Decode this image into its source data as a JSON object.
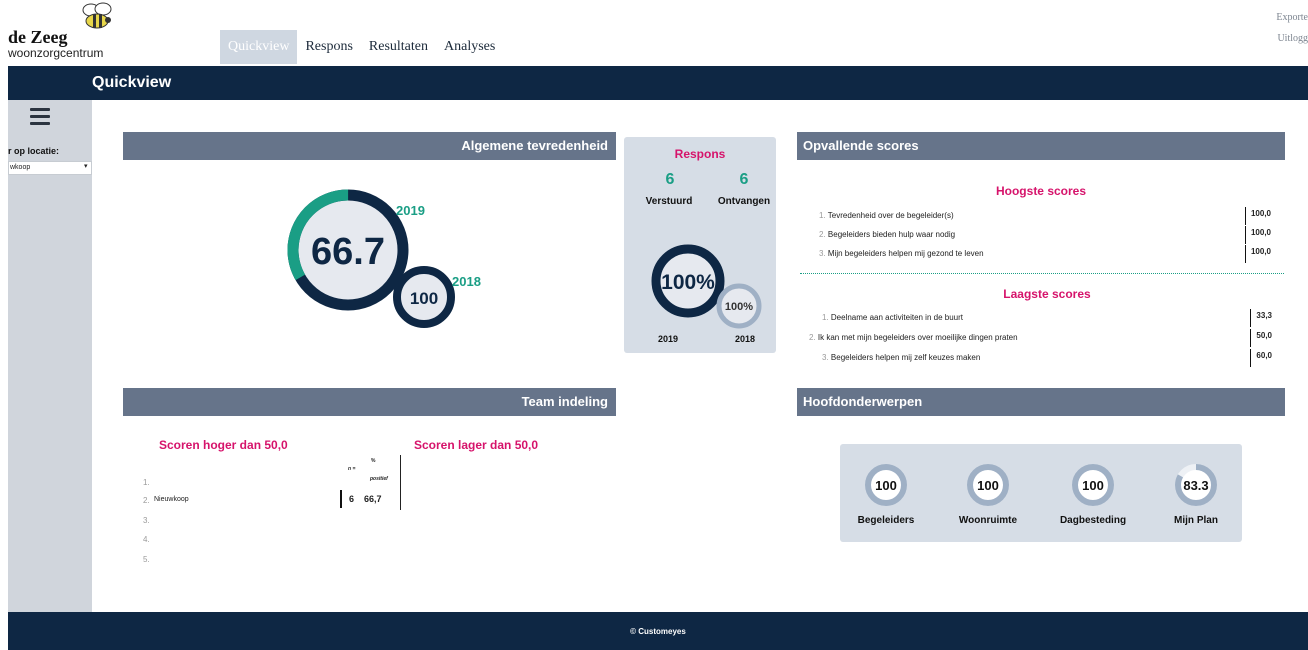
{
  "brand": {
    "name": "de Zeeg",
    "subtitle": "woonzorgcentrum",
    "logo_icon": "bee-icon"
  },
  "nav": {
    "tabs": [
      "Quickview",
      "Respons",
      "Resultaten",
      "Analyses"
    ],
    "active": "Quickview"
  },
  "top_links": {
    "export": "Exporte",
    "logout": "Uitlogg"
  },
  "page": {
    "title": "Quickview"
  },
  "sidebar": {
    "menu_icon": "hamburger-icon",
    "filter_label": "r op locatie:",
    "filter_value": "wkoop"
  },
  "algemene": {
    "title": "Algemene tevredenheid",
    "current": {
      "year": "2019",
      "value": "66.7"
    },
    "previous": {
      "year": "2018",
      "value": "100"
    }
  },
  "respons": {
    "title": "Respons",
    "verstuurd": {
      "value": "6",
      "label": "Verstuurd"
    },
    "ontvangen": {
      "value": "6",
      "label": "Ontvangen"
    },
    "current": {
      "year": "2019",
      "value": "100%"
    },
    "previous": {
      "year": "2018",
      "value": "100%"
    }
  },
  "opvallende": {
    "title": "Opvallende scores",
    "hoogste_title": "Hoogste scores",
    "hoogste": [
      {
        "idx": "1.",
        "label": "Tevredenheid over de begeleider(s)",
        "value": "100,0"
      },
      {
        "idx": "2.",
        "label": "Begeleiders bieden hulp waar nodig",
        "value": "100,0"
      },
      {
        "idx": "3.",
        "label": "Mijn begeleiders helpen mij gezond te leven",
        "value": "100,0"
      }
    ],
    "laagste_title": "Laagste scores",
    "laagste": [
      {
        "idx": "1.",
        "label": "Deelname aan activiteiten in de buurt",
        "value": "33,3"
      },
      {
        "idx": "2.",
        "label": "Ik kan met mijn begeleiders over moeilijke dingen praten",
        "value": "50,0"
      },
      {
        "idx": "3.",
        "label": "Begeleiders helpen mij zelf keuzes maken",
        "value": "60,0"
      }
    ]
  },
  "team": {
    "title": "Team indeling",
    "hoger_title": "Scoren hoger dan 50,0",
    "lager_title": "Scoren lager dan 50,0",
    "col_n": "n =",
    "col_pct_n": "%",
    "col_pct_label": "positief",
    "rows": [
      {
        "idx": "1.",
        "name": "",
        "n": "",
        "pct": ""
      },
      {
        "idx": "2.",
        "name": "Nieuwkoop",
        "n": "6",
        "pct": "66,7"
      },
      {
        "idx": "3.",
        "name": "",
        "n": "",
        "pct": ""
      },
      {
        "idx": "4.",
        "name": "",
        "n": "",
        "pct": ""
      },
      {
        "idx": "5.",
        "name": "",
        "n": "",
        "pct": ""
      }
    ]
  },
  "hoofd": {
    "title": "Hoofdonderwerpen",
    "items": [
      {
        "value": "100",
        "label": "Begeleiders",
        "fraction": 1.0
      },
      {
        "value": "100",
        "label": "Woonruimte",
        "fraction": 1.0
      },
      {
        "value": "100",
        "label": "Dagbesteding",
        "fraction": 1.0
      },
      {
        "value": "83.3",
        "label": "Mijn Plan",
        "fraction": 0.833
      }
    ]
  },
  "colors": {
    "navy": "#0e2744",
    "teal": "#1a9e85",
    "pink": "#d6136b",
    "ring_grey": "#9fb0c5",
    "bar_grey": "#66748a"
  },
  "footer": {
    "text": "© Customeyes"
  }
}
